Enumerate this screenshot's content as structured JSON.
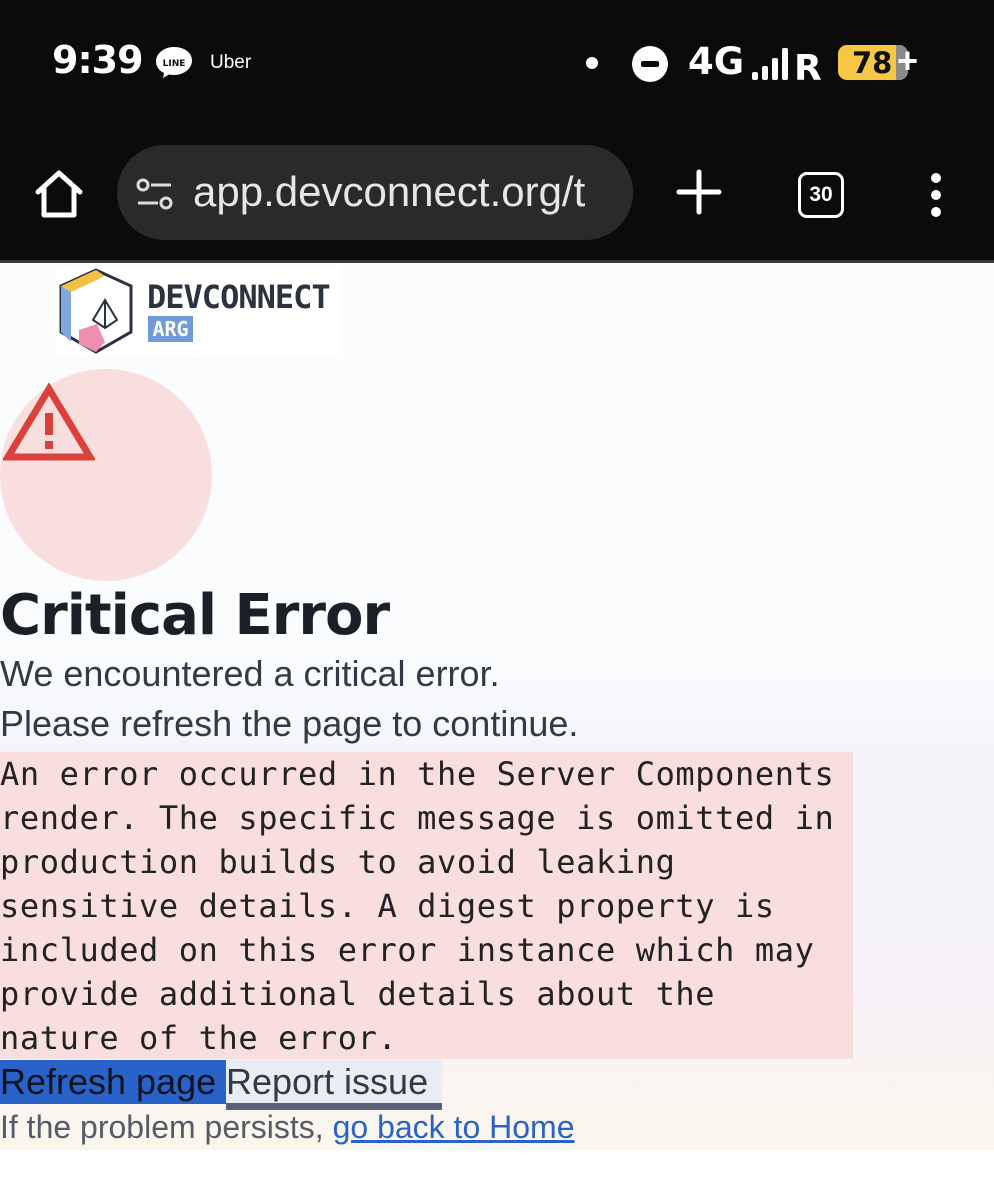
{
  "status_bar": {
    "time": "9:39",
    "apps": [
      "LINE",
      "Uber"
    ],
    "network": "4G",
    "battery_percent": "78"
  },
  "browser": {
    "url": "app.devconnect.org/t",
    "tab_count": "30"
  },
  "logo": {
    "name": "DEVCONNECT",
    "sub": "ARG"
  },
  "error": {
    "title": "Critical Error",
    "message_line1": "We encountered a critical error.",
    "message_line2": "Please refresh the page to continue.",
    "details": "An error occurred in the Server Components\nrender. The specific message is omitted in\nproduction builds to avoid leaking\nsensitive details. A digest property is\nincluded on this error instance which may\nprovide additional details about the\nnature of the error."
  },
  "actions": {
    "refresh_label": "Refresh page",
    "report_label": "Report issue"
  },
  "footer": {
    "text": "If the problem persists, ",
    "link_text": "go back to Home"
  },
  "colors": {
    "accent": "#2a63c7",
    "error_bg": "#f9dede",
    "warning_icon": "#d9423b"
  }
}
